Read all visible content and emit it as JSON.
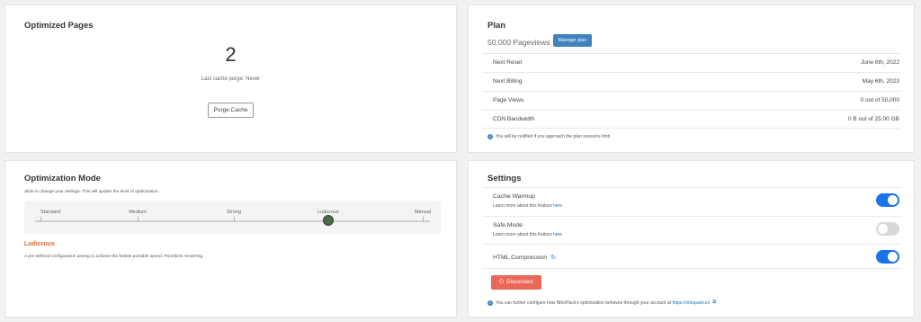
{
  "optimized_pages": {
    "title": "Optimized Pages",
    "count": "2",
    "purge_info": "Last cache purge: Never",
    "purge_button": "Purge Cache"
  },
  "plan": {
    "title": "Plan",
    "pageviews": "50,000 Pageviews",
    "manage_button": "Manage plan",
    "rows": [
      {
        "label": "Next Reset",
        "value": "June 6th, 2022"
      },
      {
        "label": "Next Billing",
        "value": "May 6th, 2023"
      },
      {
        "label": "Page Views",
        "value": "0 out of 50,000"
      },
      {
        "label": "CDN Bandwidth",
        "value": "0 B out of 25.00 GB"
      }
    ],
    "note": "You will be notified if you approach the plan resource limit",
    "info_icon": "info-icon"
  },
  "optimization_mode": {
    "title": "Optimization Mode",
    "description": "Slide to change your settings. This will update the level of optimization.",
    "levels": [
      "Standard",
      "Medium",
      "Strong",
      "Ludicrous",
      "Manual"
    ],
    "selected_level": "Ludicrous",
    "selected_description": "A pre-defined configuration aiming to achieve the fastest possible speed. Prioritizes rendering."
  },
  "settings": {
    "title": "Settings",
    "items": [
      {
        "label": "Cache Warmup",
        "sub": "Learn more about this feature",
        "link": "here",
        "enabled": true
      },
      {
        "label": "Safe Mode",
        "sub": "Learn more about this feature",
        "link": "here",
        "enabled": false
      },
      {
        "label": "HTML Compression",
        "enabled": true
      }
    ],
    "disconnect_button": "Disconnect",
    "footer_text": "You can further configure how NitroPack's optimization behaves through your account at",
    "footer_link": "https://nitropack.io/",
    "colors": {
      "toggle_on": "#1a73e8",
      "toggle_off": "#d8d8d8",
      "disconnect": "#e9685a",
      "accent": "#3f82bd",
      "mode_highlight": "#d9652b"
    }
  }
}
